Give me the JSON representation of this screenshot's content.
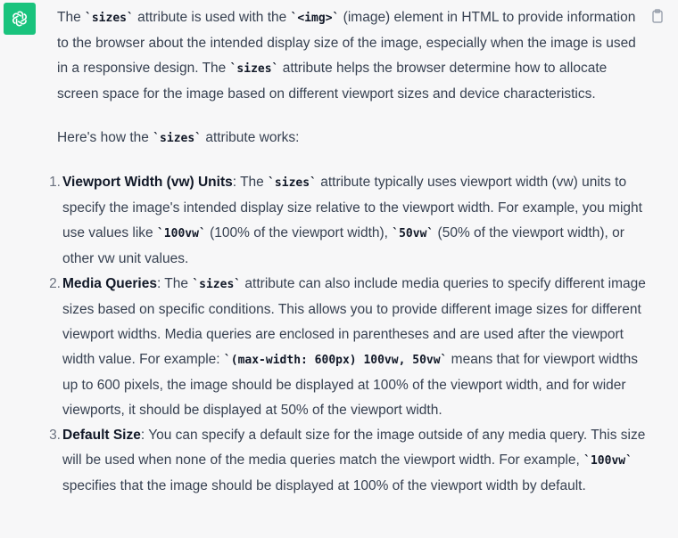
{
  "copy_icon": "clipboard-icon",
  "avatar_icon": "openai-logo-icon",
  "colors": {
    "avatar_bg": "#19c37d",
    "background": "#f7f7f8",
    "text": "#374151"
  },
  "intro": {
    "t1": "The ",
    "c1": "`sizes`",
    "t2": " attribute is used with the ",
    "c2": "`<img>`",
    "t3": " (image) element in HTML to provide information to the browser about the intended display size of the image, especially when the image is used in a responsive design. The ",
    "c3": "`sizes`",
    "t4": " attribute helps the browser determine how to allocate screen space for the image based on different viewport sizes and device characteristics."
  },
  "howto": {
    "t1": "Here's how the ",
    "c1": "`sizes`",
    "t2": " attribute works:"
  },
  "points": [
    {
      "num": "1.",
      "title": "Viewport Width (vw) Units",
      "t1": ": The ",
      "c1": "`sizes`",
      "t2": " attribute typically uses viewport width (vw) units to specify the image's intended display size relative to the viewport width. For example, you might use values like ",
      "c2": "`100vw`",
      "t3": " (100% of the viewport width), ",
      "c3": "`50vw`",
      "t4": " (50% of the viewport width), or other vw unit values."
    },
    {
      "num": "2.",
      "title": "Media Queries",
      "t1": ": The ",
      "c1": "`sizes`",
      "t2": " attribute can also include media queries to specify different image sizes based on specific conditions. This allows you to provide different image sizes for different viewport widths. Media queries are enclosed in parentheses and are used after the viewport width value. For example: ",
      "c2": "`(max-width: 600px) 100vw, 50vw`",
      "t3": " means that for viewport widths up to 600 pixels, the image should be displayed at 100% of the viewport width, and for wider viewports, it should be displayed at 50% of the viewport width."
    },
    {
      "num": "3.",
      "title": "Default Size",
      "t1": ": You can specify a default size for the image outside of any media query. This size will be used when none of the media queries match the viewport width. For example, ",
      "c1": "`100vw`",
      "t2": " specifies that the image should be displayed at 100% of the viewport width by default."
    }
  ]
}
